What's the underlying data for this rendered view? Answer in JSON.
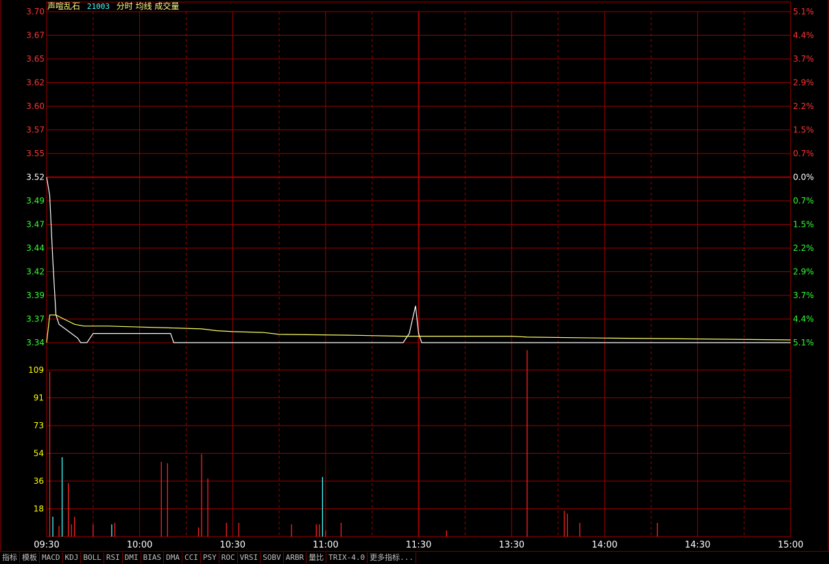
{
  "header": {
    "stock_name": "声喧乱石",
    "stock_code": "21003",
    "chart_labels": "分时 均线 成交量"
  },
  "tabs": [
    "指标",
    "模板",
    "MACD",
    "KDJ",
    "BOLL",
    "RSI",
    "DMI",
    "BIAS",
    "DMA",
    "CCI",
    "PSY",
    "ROC",
    "VRSI",
    "SOBV",
    "ARBR",
    "量比",
    "TRIX-4.0",
    "更多指标..."
  ],
  "colors": {
    "background": "#000000",
    "grid": "#a00000",
    "price_up": "#ff3333",
    "price_down": "#33ff33",
    "price_flat": "#ffffff",
    "price_line": "#ffffff",
    "avg_line": "#ffff66",
    "vol_up": "#ff2222",
    "vol_down": "#44ffff",
    "vol_axis": "#ffff00",
    "time_axis": "#ffffff"
  },
  "chart_data": [
    {
      "type": "line",
      "title": "",
      "x_unit": "minute index from 09:30",
      "prev_close": 3.52,
      "ylim": [
        3.34,
        3.7
      ],
      "y_ticks": [
        "3.70",
        "3.67",
        "3.65",
        "3.62",
        "3.60",
        "3.57",
        "3.55",
        "3.52",
        "3.49",
        "3.47",
        "3.44",
        "3.42",
        "3.39",
        "3.37",
        "3.34"
      ],
      "y_ticks_right": [
        "5.1%",
        "4.4%",
        "3.7%",
        "2.9%",
        "2.2%",
        "1.5%",
        "0.7%",
        "0.0%",
        "0.7%",
        "1.5%",
        "2.2%",
        "2.9%",
        "3.7%",
        "4.4%",
        "5.1%"
      ],
      "series": [
        {
          "key": "price",
          "points": [
            [
              0,
              3.52
            ],
            [
              1,
              3.5
            ],
            [
              2,
              3.43
            ],
            [
              3,
              3.37
            ],
            [
              4,
              3.36
            ],
            [
              6,
              3.355
            ],
            [
              8,
              3.35
            ],
            [
              10,
              3.345
            ],
            [
              11,
              3.34
            ],
            [
              13,
              3.34
            ],
            [
              15,
              3.35
            ],
            [
              20,
              3.35
            ],
            [
              30,
              3.35
            ],
            [
              40,
              3.35
            ],
            [
              41,
              3.34
            ],
            [
              60,
              3.34
            ],
            [
              80,
              3.34
            ],
            [
              100,
              3.34
            ],
            [
              115,
              3.34
            ],
            [
              117,
              3.35
            ],
            [
              119,
              3.38
            ],
            [
              120,
              3.35
            ],
            [
              121,
              3.34
            ],
            [
              125,
              3.34
            ],
            [
              150,
              3.34
            ],
            [
              200,
              3.34
            ],
            [
              240,
              3.34
            ]
          ]
        },
        {
          "key": "avg",
          "points": [
            [
              0,
              3.34
            ],
            [
              1,
              3.37
            ],
            [
              3,
              3.37
            ],
            [
              6,
              3.365
            ],
            [
              9,
              3.36
            ],
            [
              12,
              3.358
            ],
            [
              20,
              3.358
            ],
            [
              30,
              3.357
            ],
            [
              40,
              3.356
            ],
            [
              50,
              3.355
            ],
            [
              55,
              3.353
            ],
            [
              60,
              3.352
            ],
            [
              70,
              3.351
            ],
            [
              75,
              3.349
            ],
            [
              100,
              3.348
            ],
            [
              115,
              3.347
            ],
            [
              120,
              3.347
            ],
            [
              150,
              3.347
            ],
            [
              155,
              3.346
            ],
            [
              180,
              3.345
            ],
            [
              210,
              3.344
            ],
            [
              240,
              3.343
            ]
          ]
        }
      ]
    },
    {
      "type": "bar",
      "title": "",
      "x_unit": "minute index from 09:30",
      "ylim": [
        0,
        109
      ],
      "y_ticks": [
        "109",
        "91",
        "73",
        "54",
        "36",
        "18"
      ],
      "bars": [
        {
          "x": 1,
          "v": 108,
          "dir": "up"
        },
        {
          "x": 2,
          "v": 13,
          "dir": "down"
        },
        {
          "x": 4,
          "v": 7,
          "dir": "up"
        },
        {
          "x": 5,
          "v": 52,
          "dir": "down"
        },
        {
          "x": 7,
          "v": 35,
          "dir": "up"
        },
        {
          "x": 8,
          "v": 8,
          "dir": "up"
        },
        {
          "x": 9,
          "v": 13,
          "dir": "up"
        },
        {
          "x": 15,
          "v": 8,
          "dir": "up"
        },
        {
          "x": 21,
          "v": 8,
          "dir": "down"
        },
        {
          "x": 22,
          "v": 9,
          "dir": "up"
        },
        {
          "x": 37,
          "v": 49,
          "dir": "up"
        },
        {
          "x": 39,
          "v": 48,
          "dir": "up"
        },
        {
          "x": 49,
          "v": 6,
          "dir": "up"
        },
        {
          "x": 50,
          "v": 54,
          "dir": "up"
        },
        {
          "x": 52,
          "v": 38,
          "dir": "up"
        },
        {
          "x": 58,
          "v": 9,
          "dir": "up"
        },
        {
          "x": 62,
          "v": 9,
          "dir": "up"
        },
        {
          "x": 79,
          "v": 8,
          "dir": "up"
        },
        {
          "x": 87,
          "v": 8,
          "dir": "up"
        },
        {
          "x": 88,
          "v": 8,
          "dir": "up"
        },
        {
          "x": 89,
          "v": 39,
          "dir": "down"
        },
        {
          "x": 90,
          "v": 4,
          "dir": "up"
        },
        {
          "x": 95,
          "v": 9,
          "dir": "up"
        },
        {
          "x": 129,
          "v": 4,
          "dir": "up"
        },
        {
          "x": 155,
          "v": 124,
          "dir": "up"
        },
        {
          "x": 167,
          "v": 17,
          "dir": "up"
        },
        {
          "x": 168,
          "v": 15,
          "dir": "up"
        },
        {
          "x": 172,
          "v": 9,
          "dir": "up"
        },
        {
          "x": 197,
          "v": 9,
          "dir": "up"
        }
      ]
    }
  ],
  "time_axis": [
    {
      "label": "09:30",
      "min": 0
    },
    {
      "label": "10:00",
      "min": 30
    },
    {
      "label": "10:30",
      "min": 60
    },
    {
      "label": "11:00",
      "min": 90
    },
    {
      "label": "11:30",
      "min": 120
    },
    {
      "label": "13:30",
      "min": 150
    },
    {
      "label": "14:00",
      "min": 180
    },
    {
      "label": "14:30",
      "min": 210
    },
    {
      "label": "15:00",
      "min": 240
    }
  ]
}
